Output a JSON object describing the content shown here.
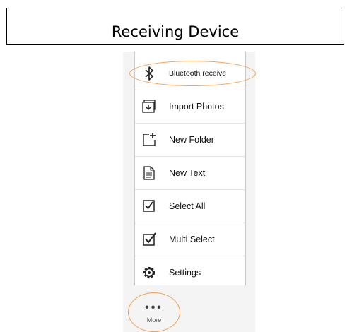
{
  "title": "Receiving Device",
  "menu": {
    "items": [
      {
        "label": "Bluetooth receive",
        "icon": "bluetooth-icon"
      },
      {
        "label": "Import Photos",
        "icon": "import-photos-icon"
      },
      {
        "label": "New Folder",
        "icon": "new-folder-icon"
      },
      {
        "label": "New Text",
        "icon": "new-text-icon"
      },
      {
        "label": "Select All",
        "icon": "select-all-icon"
      },
      {
        "label": "Multi Select",
        "icon": "multi-select-icon"
      },
      {
        "label": "Settings",
        "icon": "gear-icon"
      }
    ]
  },
  "more": {
    "label": "More",
    "icon": "more-dots-icon"
  },
  "colors": {
    "highlight": "#f0a050"
  }
}
